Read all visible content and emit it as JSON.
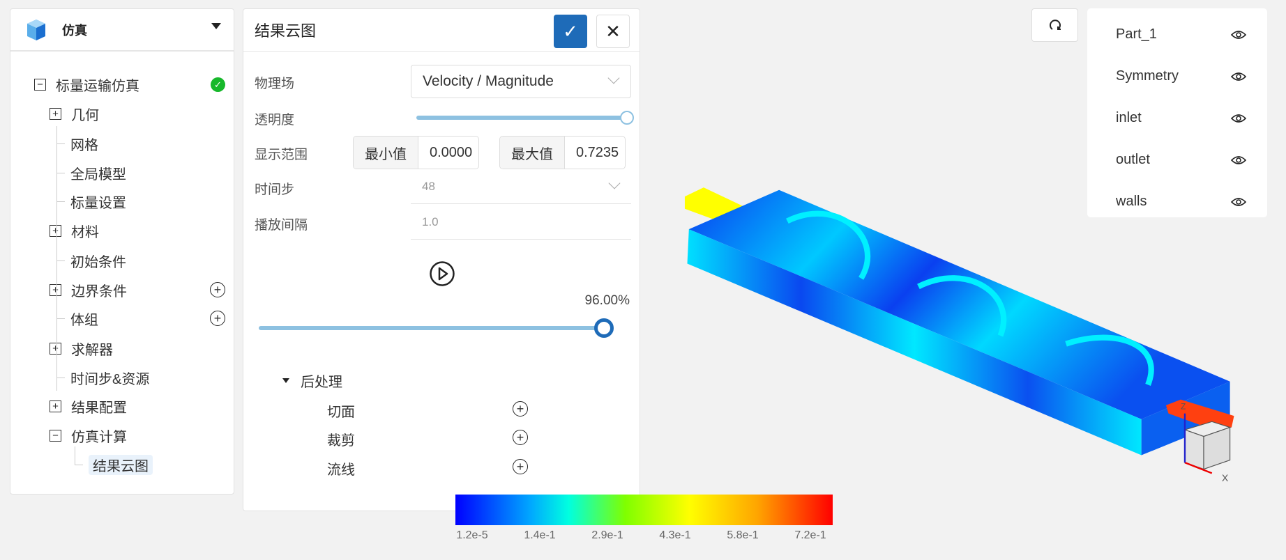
{
  "sidebar": {
    "title": "仿真",
    "tree": [
      {
        "label": "标量运输仿真",
        "toggle": "minus",
        "status": "check"
      },
      {
        "label": "几何",
        "toggle": "plus"
      },
      {
        "label": "网格"
      },
      {
        "label": "全局模型"
      },
      {
        "label": "标量设置"
      },
      {
        "label": "材料",
        "toggle": "plus"
      },
      {
        "label": "初始条件"
      },
      {
        "label": "边界条件",
        "toggle": "plus",
        "add": true
      },
      {
        "label": "体组",
        "add": true
      },
      {
        "label": "求解器",
        "toggle": "plus"
      },
      {
        "label": "时间步&资源"
      },
      {
        "label": "结果配置",
        "toggle": "plus"
      },
      {
        "label": "仿真计算",
        "toggle": "minus"
      },
      {
        "label": "结果云图",
        "selected": true
      }
    ]
  },
  "panel": {
    "title": "结果云图",
    "field_label": "物理场",
    "field_value": "Velocity / Magnitude",
    "opacity_label": "透明度",
    "opacity_value": 1.0,
    "range_label": "显示范围",
    "min_label": "最小值",
    "min_value": "0.0000",
    "max_label": "最大值",
    "max_value": "0.7235",
    "timestep_label": "时间步",
    "timestep_value": "48",
    "interval_label": "播放间隔",
    "interval_value": "1.0",
    "progress_text": "96.00%",
    "progress": 0.96,
    "post_label": "后处理",
    "post_items": [
      "切面",
      "裁剪",
      "流线"
    ]
  },
  "parts": [
    "Part_1",
    "Symmetry",
    "inlet",
    "outlet",
    "walls"
  ],
  "colorbar": {
    "ticks": [
      "1.2e-5",
      "1.4e-1",
      "2.9e-1",
      "4.3e-1",
      "5.8e-1",
      "7.2e-1"
    ],
    "colors": [
      "#0000ff",
      "#00ffff",
      "#ffff00",
      "#ff0000"
    ]
  },
  "axes": {
    "x": "X",
    "z": "Z"
  },
  "accent": "#1e6bb8"
}
